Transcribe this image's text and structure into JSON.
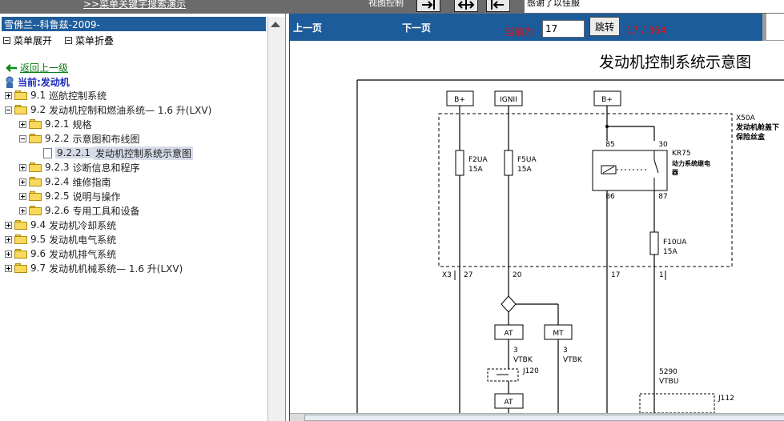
{
  "topbar": {
    "search_link": ">>菜单关键字搜索演示",
    "view_label": "视图控制",
    "note": "感谢了以佳服"
  },
  "sidebar": {
    "title": "雪佛兰--科鲁兹-2009-",
    "expand_label": "菜单展开",
    "collapse_label": "菜单折叠",
    "back_label": "返回上一级",
    "current_label": "当前:发动机",
    "tree": [
      {
        "num": "9.1",
        "label": "巡航控制系统",
        "level": 0,
        "state": "plus"
      },
      {
        "num": "9.2",
        "label": "发动机控制和燃油系统— 1.6 升(LXV)",
        "level": 0,
        "state": "minus"
      },
      {
        "num": "9.2.1",
        "label": "规格",
        "level": 1,
        "state": "plus"
      },
      {
        "num": "9.2.2",
        "label": "示意图和布线图",
        "level": 1,
        "state": "minus"
      },
      {
        "num": "9.2.2.1",
        "label": "发动机控制系统示意图",
        "level": 2,
        "state": "doc",
        "selected": true
      },
      {
        "num": "9.2.3",
        "label": "诊断信息和程序",
        "level": 1,
        "state": "plus"
      },
      {
        "num": "9.2.4",
        "label": "维修指南",
        "level": 1,
        "state": "plus"
      },
      {
        "num": "9.2.5",
        "label": "说明与操作",
        "level": 1,
        "state": "plus"
      },
      {
        "num": "9.2.6",
        "label": "专用工具和设备",
        "level": 1,
        "state": "plus"
      },
      {
        "num": "9.4",
        "label": "发动机冷却系统",
        "level": 0,
        "state": "plus"
      },
      {
        "num": "9.5",
        "label": "发动机电气系统",
        "level": 0,
        "state": "plus"
      },
      {
        "num": "9.6",
        "label": "发动机排气系统",
        "level": 0,
        "state": "plus"
      },
      {
        "num": "9.7",
        "label": "发动机机械系统— 1.6 升(LXV)",
        "level": 0,
        "state": "plus"
      }
    ]
  },
  "viewer": {
    "prev_label": "上一页",
    "next_label": "下一页",
    "current_label": "当前为",
    "page_value": "17",
    "jump_label": "跳转",
    "page_total": "17 / 364"
  },
  "diagram": {
    "title": "发动机控制系统示意图",
    "b_plus_1": "B+",
    "ignii": "IGNII",
    "b_plus_2": "B+",
    "x50a": "X50A",
    "box_label_1": "发动机舱盖下",
    "box_label_2": "保险丝盒",
    "fuse_f2ua": "F2UA",
    "fuse_f2ua_amp": "15A",
    "fuse_f5ua": "F5UA",
    "fuse_f5ua_amp": "15A",
    "relay_pin_85": "85",
    "relay_pin_30": "30",
    "relay_pin_86": "86",
    "relay_pin_87": "87",
    "relay_name": "KR75",
    "relay_desc_1": "动力系统继电",
    "relay_desc_2": "器",
    "fuse_f10ua": "F10UA",
    "fuse_f10ua_amp": "15A",
    "x3": "X3",
    "pin_27": "27",
    "pin_20": "20",
    "pin_17": "17",
    "pin_1": "1",
    "at_1": "AT",
    "mt": "MT",
    "wire_at_gauge": "3",
    "wire_at_color": "VTBK",
    "wire_mt_gauge": "3",
    "wire_mt_color": "VTBK",
    "j120": "J120",
    "at_2": "AT",
    "wire_5290": "5290",
    "wire_5290_color": "VTBU",
    "j112": "J112"
  }
}
